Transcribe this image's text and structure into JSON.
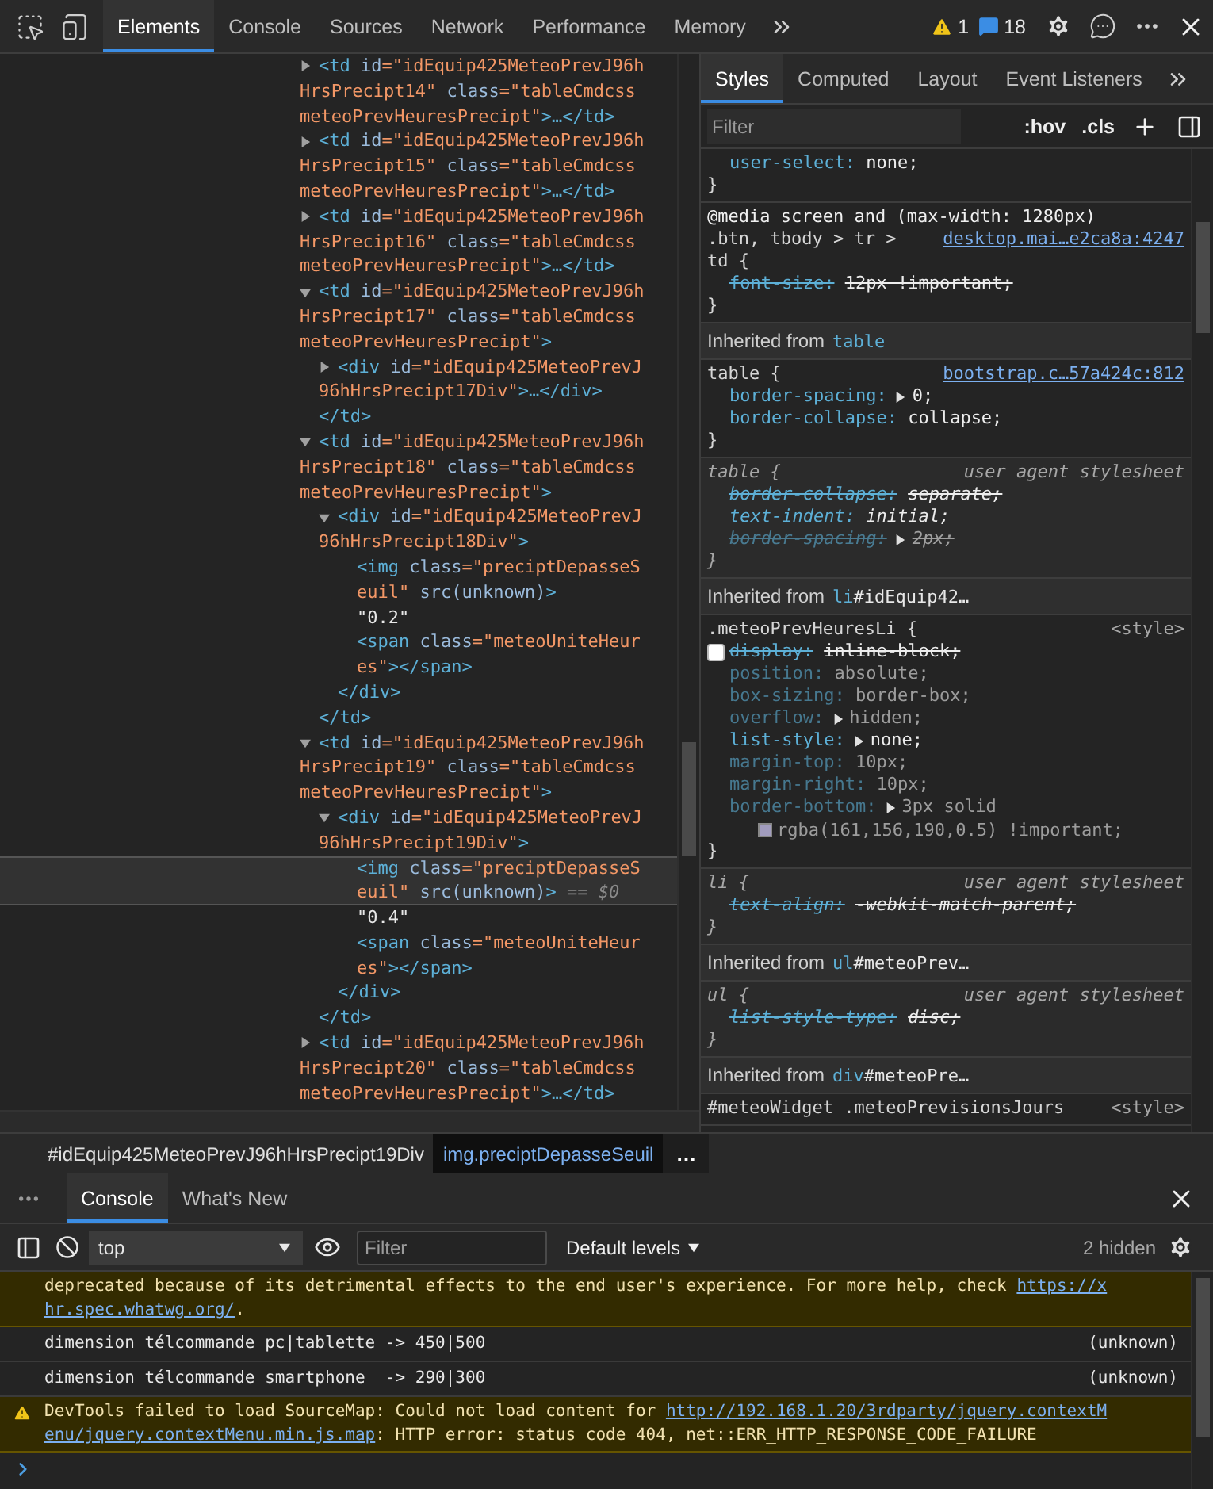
{
  "toolbar": {
    "tabs": [
      {
        "label": "Elements",
        "selected": true
      },
      {
        "label": "Console",
        "selected": false
      },
      {
        "label": "Sources",
        "selected": false
      },
      {
        "label": "Network",
        "selected": false
      },
      {
        "label": "Performance",
        "selected": false
      },
      {
        "label": "Memory",
        "selected": false
      }
    ],
    "warnings": "1",
    "messages": "18"
  },
  "dom_tree": [
    {
      "kind": "element",
      "expanded": false,
      "selected": false,
      "lines": [
        [
          {
            "kind": "tag",
            "text": "<td"
          },
          {
            "kind": "attr",
            "text": "id"
          },
          {
            "kind": "value",
            "text": "=\"idEquip425MeteoPrevJ96h"
          }
        ],
        [
          {
            "kind": "value",
            "text": "HrsPrecipt14\""
          },
          {
            "kind": "attr",
            "text": "class"
          },
          {
            "kind": "value",
            "text": "=\"tableCmdcss"
          }
        ],
        [
          {
            "kind": "value",
            "text": "meteoPrevHeuresPrecipt\""
          },
          {
            "kind": "tag",
            "text": ">…</td>"
          }
        ]
      ]
    },
    {
      "kind": "element",
      "expanded": false,
      "selected": false,
      "lines": [
        [
          {
            "kind": "tag",
            "text": "<td"
          },
          {
            "kind": "attr",
            "text": "id"
          },
          {
            "kind": "value",
            "text": "=\"idEquip425MeteoPrevJ96h"
          }
        ],
        [
          {
            "kind": "value",
            "text": "HrsPrecipt15\""
          },
          {
            "kind": "attr",
            "text": "class"
          },
          {
            "kind": "value",
            "text": "=\"tableCmdcss"
          }
        ],
        [
          {
            "kind": "value",
            "text": "meteoPrevHeuresPrecipt\""
          },
          {
            "kind": "tag",
            "text": ">…</td>"
          }
        ]
      ]
    },
    {
      "kind": "element",
      "expanded": false,
      "selected": false,
      "lines": [
        [
          {
            "kind": "tag",
            "text": "<td"
          },
          {
            "kind": "attr",
            "text": "id"
          },
          {
            "kind": "value",
            "text": "=\"idEquip425MeteoPrevJ96h"
          }
        ],
        [
          {
            "kind": "value",
            "text": "HrsPrecipt16\""
          },
          {
            "kind": "attr",
            "text": "class"
          },
          {
            "kind": "value",
            "text": "=\"tableCmdcss"
          }
        ],
        [
          {
            "kind": "value",
            "text": "meteoPrevHeuresPrecipt\""
          },
          {
            "kind": "tag",
            "text": ">…</td>"
          }
        ]
      ]
    },
    {
      "kind": "element",
      "expanded": true,
      "selected": false,
      "lines": [
        [
          {
            "kind": "tag",
            "text": "<td"
          },
          {
            "kind": "attr",
            "text": "id"
          },
          {
            "kind": "value",
            "text": "=\"idEquip425MeteoPrevJ96h"
          }
        ],
        [
          {
            "kind": "value",
            "text": "HrsPrecipt17\""
          },
          {
            "kind": "attr",
            "text": "class"
          },
          {
            "kind": "value",
            "text": "=\"tableCmdcss"
          }
        ],
        [
          {
            "kind": "value",
            "text": "meteoPrevHeuresPrecipt\""
          },
          {
            "kind": "tag",
            "text": ">"
          }
        ]
      ],
      "children": [
        {
          "kind": "element",
          "expanded": false,
          "selected": false,
          "lines": [
            [
              {
                "kind": "tag",
                "text": "<div"
              },
              {
                "kind": "attr",
                "text": "id"
              },
              {
                "kind": "value",
                "text": "=\"idEquip425MeteoPrevJ"
              }
            ],
            [
              {
                "kind": "value",
                "text": "96hHrsPrecipt17Div\""
              },
              {
                "kind": "tag",
                "text": ">…</div>"
              }
            ]
          ]
        }
      ],
      "close": [
        {
          "kind": "tag",
          "text": "</td>"
        }
      ]
    },
    {
      "kind": "element",
      "expanded": true,
      "selected": false,
      "lines": [
        [
          {
            "kind": "tag",
            "text": "<td"
          },
          {
            "kind": "attr",
            "text": "id"
          },
          {
            "kind": "value",
            "text": "=\"idEquip425MeteoPrevJ96h"
          }
        ],
        [
          {
            "kind": "value",
            "text": "HrsPrecipt18\""
          },
          {
            "kind": "attr",
            "text": "class"
          },
          {
            "kind": "value",
            "text": "=\"tableCmdcss"
          }
        ],
        [
          {
            "kind": "value",
            "text": "meteoPrevHeuresPrecipt\""
          },
          {
            "kind": "tag",
            "text": ">"
          }
        ]
      ],
      "children": [
        {
          "kind": "element",
          "expanded": true,
          "selected": false,
          "lines": [
            [
              {
                "kind": "tag",
                "text": "<div"
              },
              {
                "kind": "attr",
                "text": "id"
              },
              {
                "kind": "value",
                "text": "=\"idEquip425MeteoPrevJ"
              }
            ],
            [
              {
                "kind": "value",
                "text": "96hHrsPrecipt18Div\""
              },
              {
                "kind": "tag",
                "text": ">"
              }
            ]
          ],
          "children": [
            {
              "kind": "leaf",
              "selected": false,
              "lines": [
                [
                  {
                    "kind": "tag",
                    "text": "<img"
                  },
                  {
                    "kind": "attr",
                    "text": "class"
                  },
                  {
                    "kind": "value",
                    "text": "=\"preciptDepasseS"
                  }
                ],
                [
                  {
                    "kind": "value",
                    "text": "euil\""
                  },
                  {
                    "kind": "attr",
                    "text": "src(unknown)"
                  },
                  {
                    "kind": "tag",
                    "text": ">"
                  }
                ]
              ]
            },
            {
              "kind": "leaf",
              "selected": false,
              "lines": [
                [
                  {
                    "kind": "text",
                    "text": "\"0.2\""
                  }
                ]
              ]
            },
            {
              "kind": "leaf",
              "selected": false,
              "lines": [
                [
                  {
                    "kind": "tag",
                    "text": "<span"
                  },
                  {
                    "kind": "attr",
                    "text": "class"
                  },
                  {
                    "kind": "value",
                    "text": "=\"meteoUniteHeur"
                  }
                ],
                [
                  {
                    "kind": "value",
                    "text": "es\""
                  },
                  {
                    "kind": "tag",
                    "text": "></span>"
                  }
                ]
              ]
            }
          ],
          "close": [
            {
              "kind": "tag",
              "text": "</div>"
            }
          ]
        }
      ],
      "close": [
        {
          "kind": "tag",
          "text": "</td>"
        }
      ]
    },
    {
      "kind": "element",
      "expanded": true,
      "selected": false,
      "lines": [
        [
          {
            "kind": "tag",
            "text": "<td"
          },
          {
            "kind": "attr",
            "text": "id"
          },
          {
            "kind": "value",
            "text": "=\"idEquip425MeteoPrevJ96h"
          }
        ],
        [
          {
            "kind": "value",
            "text": "HrsPrecipt19\""
          },
          {
            "kind": "attr",
            "text": "class"
          },
          {
            "kind": "value",
            "text": "=\"tableCmdcss"
          }
        ],
        [
          {
            "kind": "value",
            "text": "meteoPrevHeuresPrecipt\""
          },
          {
            "kind": "tag",
            "text": ">"
          }
        ]
      ],
      "children": [
        {
          "kind": "element",
          "expanded": true,
          "selected": false,
          "lines": [
            [
              {
                "kind": "tag",
                "text": "<div"
              },
              {
                "kind": "attr",
                "text": "id"
              },
              {
                "kind": "value",
                "text": "=\"idEquip425MeteoPrevJ"
              }
            ],
            [
              {
                "kind": "value",
                "text": "96hHrsPrecipt19Div\""
              },
              {
                "kind": "tag",
                "text": ">"
              }
            ]
          ],
          "children": [
            {
              "kind": "leaf",
              "selected": true,
              "lines": [
                [
                  {
                    "kind": "tag",
                    "text": "<img"
                  },
                  {
                    "kind": "attr",
                    "text": "class"
                  },
                  {
                    "kind": "value",
                    "text": "=\"preciptDepasseS"
                  }
                ],
                [
                  {
                    "kind": "value",
                    "text": "euil\""
                  },
                  {
                    "kind": "attr",
                    "text": "src(unknown)"
                  },
                  {
                    "kind": "tag",
                    "text": ">"
                  },
                  {
                    "kind": "hint",
                    "text": "== $0"
                  }
                ]
              ]
            },
            {
              "kind": "leaf",
              "selected": false,
              "lines": [
                [
                  {
                    "kind": "text",
                    "text": "\"0.4\""
                  }
                ]
              ]
            },
            {
              "kind": "leaf",
              "selected": false,
              "lines": [
                [
                  {
                    "kind": "tag",
                    "text": "<span"
                  },
                  {
                    "kind": "attr",
                    "text": "class"
                  },
                  {
                    "kind": "value",
                    "text": "=\"meteoUniteHeur"
                  }
                ],
                [
                  {
                    "kind": "value",
                    "text": "es\""
                  },
                  {
                    "kind": "tag",
                    "text": "></span>"
                  }
                ]
              ]
            }
          ],
          "close": [
            {
              "kind": "tag",
              "text": "</div>"
            }
          ]
        }
      ],
      "close": [
        {
          "kind": "tag",
          "text": "</td>"
        }
      ]
    },
    {
      "kind": "element",
      "expanded": false,
      "selected": false,
      "lines": [
        [
          {
            "kind": "tag",
            "text": "<td"
          },
          {
            "kind": "attr",
            "text": "id"
          },
          {
            "kind": "value",
            "text": "=\"idEquip425MeteoPrevJ96h"
          }
        ],
        [
          {
            "kind": "value",
            "text": "HrsPrecipt20\""
          },
          {
            "kind": "attr",
            "text": "class"
          },
          {
            "kind": "value",
            "text": "=\"tableCmdcss"
          }
        ],
        [
          {
            "kind": "value",
            "text": "meteoPrevHeuresPrecipt\""
          },
          {
            "kind": "tag",
            "text": ">…</td>"
          }
        ]
      ]
    }
  ],
  "breadcrumbs": {
    "items": [
      {
        "text": "#idEquip425MeteoPrevJ96hHrsPrecipt19Div",
        "selected": false
      },
      {
        "text": "img.preciptDepasseSeuil",
        "selected": true
      }
    ],
    "more": "…"
  },
  "styles": {
    "tabs": [
      {
        "label": "Styles",
        "selected": true
      },
      {
        "label": "Computed",
        "selected": false
      },
      {
        "label": "Layout",
        "selected": false
      },
      {
        "label": "Event Listeners",
        "selected": false
      }
    ],
    "filter_placeholder": "Filter",
    "hov": ":hov",
    "cls": ".cls",
    "sections": [
      {
        "kind": "rule",
        "user_agent": false,
        "props": [
          {
            "name": "user-select:",
            "value": "none;",
            "struck": false,
            "dimmed": false,
            "expandable": false
          }
        ],
        "close": "}"
      },
      {
        "kind": "rule",
        "user_agent": false,
        "media": "@media screen and (max-width: 1280px)",
        "selector_lines": [
          ".btn, tbody > tr >",
          "td {"
        ],
        "source": "desktop.mai…e2ca8a:4247",
        "source_link": true,
        "props": [
          {
            "name": "font-size:",
            "value": "12px !important;",
            "struck": true,
            "dimmed": false,
            "expandable": false
          }
        ],
        "close": "}"
      },
      {
        "kind": "inherited",
        "label": "Inherited from",
        "target_tag": "table"
      },
      {
        "kind": "rule",
        "user_agent": false,
        "selector_lines": [
          "table {"
        ],
        "source": "bootstrap.c…57a424c:812",
        "source_link": true,
        "props": [
          {
            "name": "border-spacing:",
            "value": "0;",
            "struck": false,
            "dimmed": false,
            "expandable": true
          },
          {
            "name": "border-collapse:",
            "value": "collapse;",
            "struck": false,
            "dimmed": false,
            "expandable": false
          }
        ],
        "close": "}"
      },
      {
        "kind": "rule",
        "user_agent": true,
        "selector_lines": [
          "table {"
        ],
        "source": "user agent stylesheet",
        "source_link": false,
        "props": [
          {
            "name": "border-collapse:",
            "value": "separate;",
            "struck": true,
            "dimmed": false,
            "expandable": false
          },
          {
            "name": "text-indent:",
            "value": "initial;",
            "struck": false,
            "dimmed": false,
            "expandable": false
          },
          {
            "name": "border-spacing:",
            "value": "2px;",
            "struck": true,
            "dimmed": true,
            "expandable": true
          }
        ],
        "close": "}"
      },
      {
        "kind": "inherited",
        "label": "Inherited from",
        "target_tag": "li",
        "target_rest": "#idEquip42…"
      },
      {
        "kind": "rule",
        "user_agent": false,
        "selector_lines": [
          ".meteoPrevHeuresLi {"
        ],
        "source": "<style>",
        "source_link": false,
        "props": [
          {
            "name": "display:",
            "value": "inline-block;",
            "struck": true,
            "dimmed": false,
            "expandable": false,
            "checked": false
          },
          {
            "name": "position:",
            "value": "absolute;",
            "struck": false,
            "dimmed": true,
            "expandable": false
          },
          {
            "name": "box-sizing:",
            "value": "border-box;",
            "struck": false,
            "dimmed": true,
            "expandable": false
          },
          {
            "name": "overflow:",
            "value": "hidden;",
            "struck": false,
            "dimmed": true,
            "expandable": true
          },
          {
            "name": "list-style:",
            "value": "none;",
            "struck": false,
            "dimmed": false,
            "expandable": true
          },
          {
            "name": "margin-top:",
            "value": "10px;",
            "struck": false,
            "dimmed": true,
            "expandable": false
          },
          {
            "name": "margin-right:",
            "value": "10px;",
            "struck": false,
            "dimmed": true,
            "expandable": false
          },
          {
            "name": "border-bottom:",
            "value": "3px solid",
            "struck": false,
            "dimmed": true,
            "expandable": true,
            "continuation": "rgba(161,156,190,0.5) !important;",
            "color": "#a19cbe"
          }
        ],
        "close": "}"
      },
      {
        "kind": "rule",
        "user_agent": true,
        "selector_lines": [
          "li {"
        ],
        "source": "user agent stylesheet",
        "source_link": false,
        "props": [
          {
            "name": "text-align:",
            "value": "-webkit-match-parent;",
            "struck": true,
            "dimmed": false,
            "expandable": false
          }
        ],
        "close": "}"
      },
      {
        "kind": "inherited",
        "label": "Inherited from",
        "target_tag": "ul",
        "target_rest": "#meteoPrev…"
      },
      {
        "kind": "rule",
        "user_agent": true,
        "selector_lines": [
          "ul {"
        ],
        "source": "user agent stylesheet",
        "source_link": false,
        "props": [
          {
            "name": "list-style-type:",
            "value": "disc;",
            "struck": true,
            "dimmed": false,
            "expandable": false
          }
        ],
        "close": "}"
      },
      {
        "kind": "inherited",
        "label": "Inherited from",
        "target_tag": "div",
        "target_rest": "#meteoPre…"
      },
      {
        "kind": "rule",
        "user_agent": false,
        "selector_lines": [
          "#meteoWidget .meteoPrevisionsJours"
        ],
        "source": "<style>",
        "source_link": false
      }
    ]
  },
  "drawer": {
    "tabs": [
      {
        "label": "Console",
        "selected": true
      },
      {
        "label": "What's New",
        "selected": false
      }
    ]
  },
  "console_toolbar": {
    "context": "top",
    "filter_placeholder": "Filter",
    "levels": "Default levels",
    "hidden": "2 hidden"
  },
  "messages": [
    {
      "kind": "warning",
      "truncated_top": true,
      "lines": [
        [
          {
            "kind": "text",
            "text": "deprecated because of its detrimental effects to the end user's experience. For more help, check "
          },
          {
            "kind": "link",
            "text": "https://x"
          }
        ],
        [
          {
            "kind": "link",
            "text": "hr.spec.whatwg.org/"
          },
          {
            "kind": "text",
            "text": "."
          }
        ]
      ]
    },
    {
      "kind": "log",
      "lines": [
        [
          {
            "kind": "text",
            "text": "dimension télcommande pc|tablette -> 450|500"
          }
        ]
      ],
      "source": "(unknown)"
    },
    {
      "kind": "log",
      "lines": [
        [
          {
            "kind": "text",
            "text": "dimension télcommande smartphone  -> 290|300"
          }
        ]
      ],
      "source": "(unknown)"
    },
    {
      "kind": "warning",
      "truncated_top": false,
      "lines": [
        [
          {
            "kind": "text",
            "text": "DevTools failed to load SourceMap: Could not load content for "
          },
          {
            "kind": "link",
            "text": "http://192.168.1.20/3rdparty/jquery.contextM"
          }
        ],
        [
          {
            "kind": "link",
            "text": "enu/jquery.contextMenu.min.js.map"
          },
          {
            "kind": "text",
            "text": ": HTTP error: status code 404, net::ERR_HTTP_RESPONSE_CODE_FAILURE"
          }
        ]
      ]
    }
  ]
}
